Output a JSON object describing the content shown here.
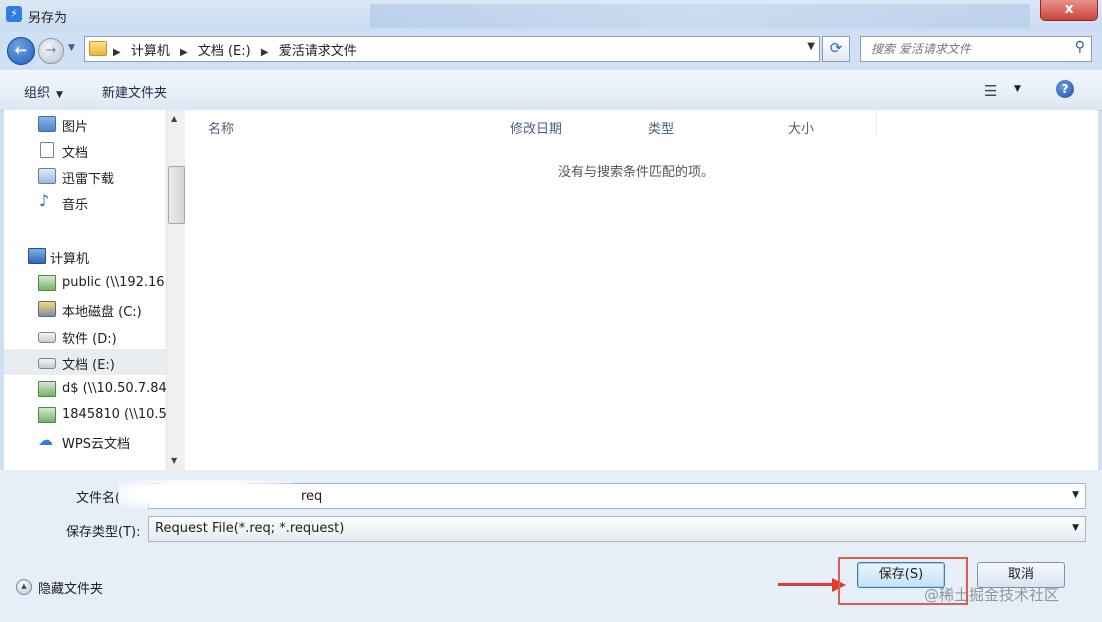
{
  "window": {
    "title": "另存为",
    "close_label": "x"
  },
  "address": {
    "crumbs": [
      "计算机",
      "文档 (E:)",
      "爱活请求文件"
    ],
    "search_placeholder": "搜索 爱活请求文件"
  },
  "toolbar": {
    "organize_label": "组织",
    "new_folder_label": "新建文件夹"
  },
  "nav_pane": {
    "items": [
      {
        "label": "图片",
        "icon": "picture-icon"
      },
      {
        "label": "文档",
        "icon": "document-icon"
      },
      {
        "label": "迅雷下载",
        "icon": "download-folder-icon"
      },
      {
        "label": "音乐",
        "icon": "music-icon"
      },
      {
        "label": "计算机",
        "icon": "computer-icon"
      },
      {
        "label": "public (\\\\192.16",
        "icon": "network-drive-icon"
      },
      {
        "label": "本地磁盘 (C:)",
        "icon": "system-drive-icon"
      },
      {
        "label": "软件 (D:)",
        "icon": "drive-icon"
      },
      {
        "label": "文档 (E:)",
        "icon": "drive-icon",
        "selected": true
      },
      {
        "label": "d$ (\\\\10.50.7.84",
        "icon": "network-drive-icon"
      },
      {
        "label": "1845810 (\\\\10.5",
        "icon": "network-drive-icon"
      },
      {
        "label": "WPS云文档",
        "icon": "cloud-icon"
      }
    ]
  },
  "file_list": {
    "columns": [
      "名称",
      "修改日期",
      "类型",
      "大小"
    ],
    "empty_message": "没有与搜索条件匹配的项。"
  },
  "form": {
    "filename_label": "文件名(",
    "filename_value": "req",
    "filetype_label": "保存类型(T):",
    "filetype_value": "Request File(*.req; *.request)"
  },
  "footer": {
    "hide_folders_label": "隐藏文件夹",
    "save_label": "保存(S)",
    "cancel_label": "取消"
  },
  "watermark": "@稀土掘金技术社区",
  "colors": {
    "highlight": "#e25b50",
    "arrow": "#e23a2e"
  }
}
